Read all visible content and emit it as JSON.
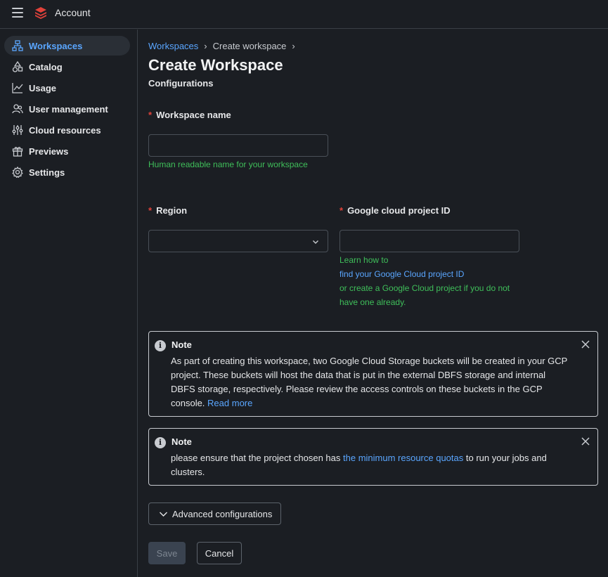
{
  "app": {
    "title": "Account"
  },
  "sidebar": {
    "items": [
      {
        "label": "Workspaces",
        "icon": "workspaces-icon",
        "active": true
      },
      {
        "label": "Catalog",
        "icon": "catalog-icon"
      },
      {
        "label": "Usage",
        "icon": "usage-chart-icon"
      },
      {
        "label": "User management",
        "icon": "users-icon"
      },
      {
        "label": "Cloud resources",
        "icon": "sliders-icon"
      },
      {
        "label": "Previews",
        "icon": "gift-icon"
      },
      {
        "label": "Settings",
        "icon": "gear-icon"
      }
    ]
  },
  "breadcrumb": {
    "root": "Workspaces",
    "current": "Create workspace",
    "sep": "›"
  },
  "page": {
    "title": "Create Workspace",
    "section": "Configurations"
  },
  "form": {
    "required_mark": "*",
    "workspace_name": {
      "label": "Workspace name",
      "value": "",
      "help": "Human readable name for your workspace"
    },
    "region": {
      "label": "Region",
      "value": ""
    },
    "gcp_project": {
      "label": "Google cloud project ID",
      "value": "",
      "help_line1": "Learn how to",
      "help_link": "find your Google Cloud project ID",
      "help_line3": "or create a Google Cloud project if you do not",
      "help_line4": "have one already."
    }
  },
  "notes": [
    {
      "title": "Note",
      "body": "As part of creating this workspace, two Google Cloud Storage buckets will be created in your GCP project. These buckets will host the data that is put in the external DBFS storage and internal DBFS storage, respectively. Please review the access controls on these buckets in the GCP console.",
      "link": "Read more"
    },
    {
      "title": "Note",
      "body_before": "please ensure that the project chosen has",
      "link": "the minimum resource quotas",
      "body_after": "to run your jobs and clusters."
    }
  ],
  "advanced": {
    "label": "Advanced configurations"
  },
  "actions": {
    "save": "Save",
    "cancel": "Cancel"
  },
  "colors": {
    "accent": "#5aa6ff",
    "help_green": "#3fbf5a",
    "required_red": "#e0423a",
    "background": "#1b1e23"
  }
}
